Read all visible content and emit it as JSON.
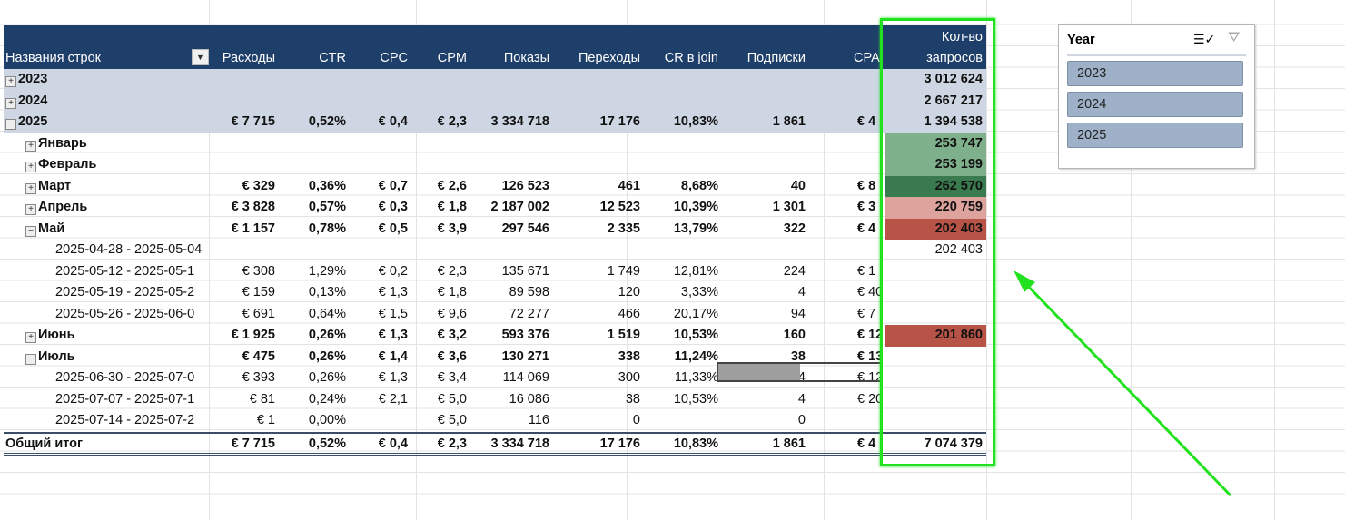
{
  "pivot": {
    "headers": {
      "row_labels": "Названия строк",
      "cost": "Расходы",
      "ctr": "CTR",
      "cpc": "CPC",
      "cpm": "CPM",
      "impressions": "Показы",
      "clicks": "Переходы",
      "cr": "CR в join",
      "subs": "Подписки",
      "cpa": "CPA",
      "req_line1": "Кол-во",
      "req_line2": "запросов"
    },
    "rows": [
      {
        "type": "year",
        "toggle": "+",
        "label": "2023",
        "v": [
          "",
          "",
          "",
          "",
          "",
          "",
          "",
          "",
          "",
          "3 012 624"
        ]
      },
      {
        "type": "year",
        "toggle": "+",
        "label": "2024",
        "v": [
          "",
          "",
          "",
          "",
          "",
          "",
          "",
          "",
          "",
          "2 667 217"
        ]
      },
      {
        "type": "year",
        "toggle": "−",
        "label": "2025",
        "v": [
          "€ 7 715",
          "0,52%",
          "€ 0,4",
          "€ 2,3",
          "3 334 718",
          "17 176",
          "10,83%",
          "1 861",
          "€ 4",
          "1 394 538"
        ]
      },
      {
        "type": "month",
        "toggle": "+",
        "label": "Январь",
        "v": [
          "",
          "",
          "",
          "",
          "",
          "",
          "",
          "",
          "",
          "253 747"
        ],
        "heat": "#7fb08c"
      },
      {
        "type": "month",
        "toggle": "+",
        "label": "Февраль",
        "v": [
          "",
          "",
          "",
          "",
          "",
          "",
          "",
          "",
          "",
          "253 199"
        ],
        "heat": "#7fb08c"
      },
      {
        "type": "month",
        "toggle": "+",
        "label": "Март",
        "v": [
          "€ 329",
          "0,36%",
          "€ 0,7",
          "€ 2,6",
          "126 523",
          "461",
          "8,68%",
          "40",
          "€ 8",
          "262 570"
        ],
        "heat": "#3a7a4f"
      },
      {
        "type": "month",
        "toggle": "+",
        "label": "Апрель",
        "v": [
          "€ 3 828",
          "0,57%",
          "€ 0,3",
          "€ 1,8",
          "2 187 002",
          "12 523",
          "10,39%",
          "1 301",
          "€ 3",
          "220 759"
        ],
        "heat": "#dda39c"
      },
      {
        "type": "month",
        "toggle": "−",
        "label": "Май",
        "v": [
          "€ 1 157",
          "0,78%",
          "€ 0,5",
          "€ 3,9",
          "297 546",
          "2 335",
          "13,79%",
          "322",
          "€ 4",
          "202 403"
        ],
        "heat": "#b85347"
      },
      {
        "type": "week",
        "label": "2025-04-28 - 2025-05-04",
        "v": [
          "",
          "",
          "",
          "",
          "",
          "",
          "",
          "",
          "",
          "202 403"
        ]
      },
      {
        "type": "week",
        "label": "2025-05-12 - 2025-05-1",
        "v": [
          "€ 308",
          "1,29%",
          "€ 0,2",
          "€ 2,3",
          "135 671",
          "1 749",
          "12,81%",
          "224",
          "€ 1",
          ""
        ]
      },
      {
        "type": "week",
        "label": "2025-05-19 - 2025-05-2",
        "v": [
          "€ 159",
          "0,13%",
          "€ 1,3",
          "€ 1,8",
          "89 598",
          "120",
          "3,33%",
          "4",
          "€ 40",
          ""
        ]
      },
      {
        "type": "week",
        "label": "2025-05-26 - 2025-06-0",
        "v": [
          "€ 691",
          "0,64%",
          "€ 1,5",
          "€ 9,6",
          "72 277",
          "466",
          "20,17%",
          "94",
          "€ 7",
          ""
        ]
      },
      {
        "type": "month",
        "toggle": "+",
        "label": "Июнь",
        "v": [
          "€ 1 925",
          "0,26%",
          "€ 1,3",
          "€ 3,2",
          "593 376",
          "1 519",
          "10,53%",
          "160",
          "€ 12",
          "201 860"
        ],
        "heat": "#b85347"
      },
      {
        "type": "month",
        "toggle": "−",
        "label": "Июль",
        "v": [
          "€ 475",
          "0,26%",
          "€ 1,4",
          "€ 3,6",
          "130 271",
          "338",
          "11,24%",
          "38",
          "€ 13",
          ""
        ]
      },
      {
        "type": "week",
        "label": "2025-06-30 - 2025-07-0",
        "v": [
          "€ 393",
          "0,26%",
          "€ 1,3",
          "€ 3,4",
          "114 069",
          "300",
          "11,33%",
          "34",
          "€ 12",
          ""
        ]
      },
      {
        "type": "week",
        "label": "2025-07-07 - 2025-07-1",
        "v": [
          "€ 81",
          "0,24%",
          "€ 2,1",
          "€ 5,0",
          "16 086",
          "38",
          "10,53%",
          "4",
          "€ 20",
          ""
        ]
      },
      {
        "type": "week",
        "label": "2025-07-14 - 2025-07-2",
        "v": [
          "€ 1",
          "0,00%",
          "",
          "€ 5,0",
          "116",
          "0",
          "",
          "0",
          "",
          ""
        ]
      },
      {
        "type": "total",
        "label": "Общий итог",
        "v": [
          "€ 7 715",
          "0,52%",
          "€ 0,4",
          "€ 2,3",
          "3 334 718",
          "17 176",
          "10,83%",
          "1 861",
          "€ 4",
          "7 074 379"
        ]
      }
    ]
  },
  "slicer": {
    "title": "Year",
    "items": [
      "2023",
      "2024",
      "2025"
    ]
  },
  "colors": {
    "header": "#1f3f6b",
    "year_band": "#cdd6e2",
    "highlight": "#22e11e",
    "slicer_item": "#9eb1c8"
  }
}
